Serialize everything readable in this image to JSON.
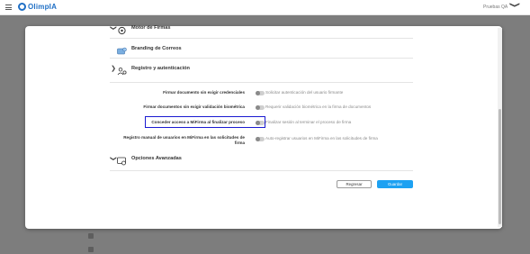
{
  "header": {
    "logo_text": "OlimpIA",
    "user_name": "Pruebas QA",
    "user_menu_chevron": "❯",
    "menu_icon": "hamburger-icon"
  },
  "sections": {
    "motor_firmas": {
      "label": "Motor de Firmas",
      "chevron": "❯",
      "icon": "signature-engine-icon"
    },
    "branding_correos": {
      "label": "Branding de Correos",
      "icon": "email-branding-icon"
    },
    "registro_autenticacion": {
      "label": "Registro y autenticación",
      "chevron": "❯",
      "icon": "registration-gear-icon"
    },
    "opciones_avanzadas": {
      "label": "Opciones Avanzadas",
      "chevron": "❯",
      "icon": "advanced-options-icon"
    }
  },
  "options": [
    {
      "label": "Firmar documento sin exigir credenciales",
      "description": "Solicitar autenticación del usuario firmante",
      "enabled": false
    },
    {
      "label": "Firmar documentos sin exigir validación biométrica",
      "description": "Requerir validación biométrica en la firma de documentos",
      "enabled": false
    },
    {
      "label": "Conceder acceso a MiFirma al finalizar proceso",
      "description": "Finalizar sesión al terminar el proceso de firma",
      "enabled": false,
      "highlighted": true
    },
    {
      "label_line1": "Registro manual de usuarios en MiFirma en las solicitudes de",
      "label_line2": "firma",
      "description": "Auto-registrar usuarios en MiFirma en las solicitudes de firma",
      "enabled": false
    }
  ],
  "footer": {
    "cancel_label": "Regresar",
    "save_label": "Guardar"
  },
  "colors": {
    "accent": "#1da1f2",
    "brand": "#1f6fc5",
    "highlight_border": "#1a1ad1"
  }
}
